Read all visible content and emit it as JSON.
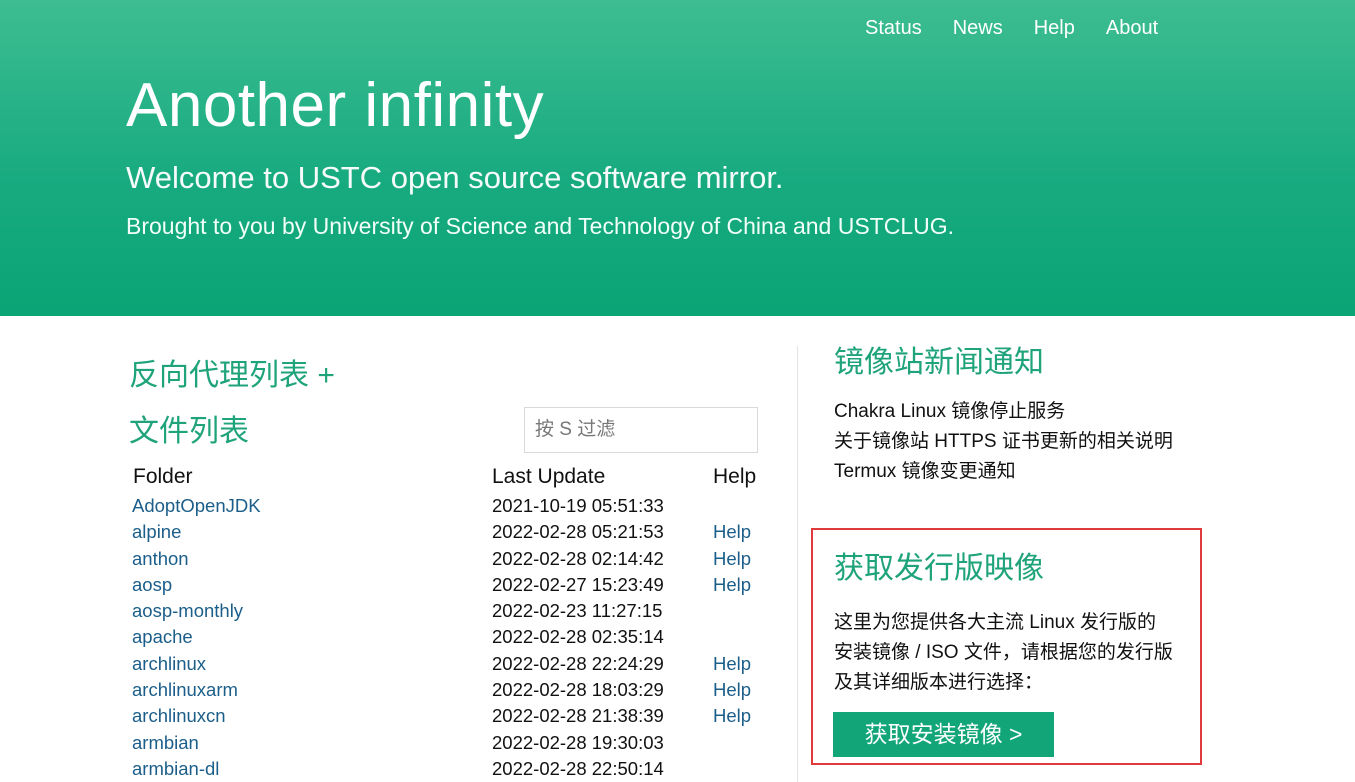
{
  "nav": {
    "items": [
      "Status",
      "News",
      "Help",
      "About"
    ]
  },
  "hero": {
    "title": "Another infinity",
    "subtitle": "Welcome to USTC open source software mirror.",
    "tagline": "Brought to you by University of Science and Technology of China and USTCLUG."
  },
  "proxy_list_title": "反向代理列表 +",
  "file_list": {
    "title": "文件列表",
    "filter_placeholder": "按 S 过滤",
    "headers": {
      "folder": "Folder",
      "last_update": "Last Update",
      "help": "Help"
    },
    "rows": [
      {
        "name": "AdoptOpenJDK",
        "date": "2021-10-19 05:51:33",
        "help": ""
      },
      {
        "name": "alpine",
        "date": "2022-02-28 05:21:53",
        "help": "Help"
      },
      {
        "name": "anthon",
        "date": "2022-02-28 02:14:42",
        "help": "Help"
      },
      {
        "name": "aosp",
        "date": "2022-02-27 15:23:49",
        "help": "Help"
      },
      {
        "name": "aosp-monthly",
        "date": "2022-02-23 11:27:15",
        "help": ""
      },
      {
        "name": "apache",
        "date": "2022-02-28 02:35:14",
        "help": ""
      },
      {
        "name": "archlinux",
        "date": "2022-02-28 22:24:29",
        "help": "Help"
      },
      {
        "name": "archlinuxarm",
        "date": "2022-02-28 18:03:29",
        "help": "Help"
      },
      {
        "name": "archlinuxcn",
        "date": "2022-02-28 21:38:39",
        "help": "Help"
      },
      {
        "name": "armbian",
        "date": "2022-02-28 19:30:03",
        "help": ""
      },
      {
        "name": "armbian-dl",
        "date": "2022-02-28 22:50:14",
        "help": ""
      }
    ]
  },
  "news": {
    "title": "镜像站新闻通知",
    "items": [
      "Chakra Linux 镜像停止服务",
      "关于镜像站 HTTPS 证书更新的相关说明",
      "Termux 镜像变更通知"
    ]
  },
  "iso": {
    "title": "获取发行版映像",
    "description": "这里为您提供各大主流 Linux 发行版的安装镜像 / ISO 文件，请根据您的发行版及其详细版本进行选择：",
    "button_label": "获取安装镜像 >"
  },
  "colors": {
    "brand": "#1fa37a",
    "header_top": "#3dbd91",
    "header_bottom": "#0aa475",
    "link": "#1b5e8a",
    "highlight_border": "#e03a3a"
  }
}
